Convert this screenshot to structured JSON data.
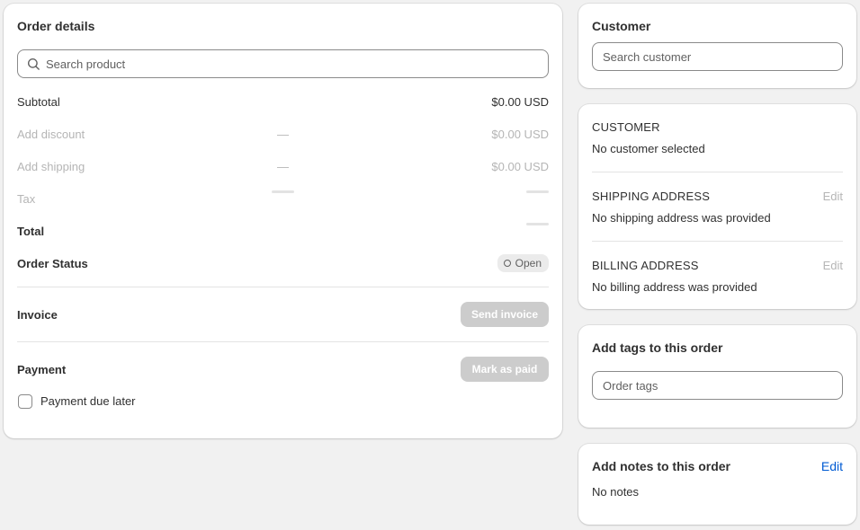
{
  "order_details": {
    "title": "Order details",
    "search_placeholder": "Search product",
    "subtotal_label": "Subtotal",
    "subtotal_value": "$0.00 USD",
    "discount_label": "Add discount",
    "discount_mid": "—",
    "discount_value": "$0.00 USD",
    "shipping_label": "Add shipping",
    "shipping_mid": "—",
    "shipping_value": "$0.00 USD",
    "tax_label": "Tax",
    "total_label": "Total",
    "status_label": "Order Status",
    "status_badge": "Open",
    "invoice_label": "Invoice",
    "send_invoice_button": "Send invoice",
    "payment_label": "Payment",
    "mark_paid_button": "Mark as paid",
    "payment_due_later": "Payment due later"
  },
  "customer_search": {
    "title": "Customer",
    "placeholder": "Search customer"
  },
  "customer_info": {
    "customer_heading": "CUSTOMER",
    "customer_text": "No customer selected",
    "shipping_heading": "SHIPPING ADDRESS",
    "shipping_edit": "Edit",
    "shipping_text": "No shipping address was provided",
    "billing_heading": "BILLING ADDRESS",
    "billing_edit": "Edit",
    "billing_text": "No billing address was provided"
  },
  "tags": {
    "title": "Add tags to this order",
    "placeholder": "Order tags"
  },
  "notes": {
    "title": "Add notes to this order",
    "edit": "Edit",
    "text": "No notes"
  },
  "colors": {
    "link": "#005bd3",
    "muted": "#b5b5b5",
    "disabled_button": "#cccccc",
    "background": "#f1f1f1"
  },
  "icons": {
    "search": "search-icon",
    "status": "circle-outline-icon"
  }
}
